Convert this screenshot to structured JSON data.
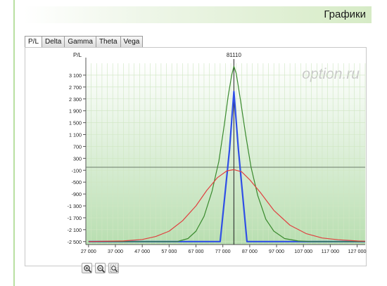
{
  "header": {
    "title": "Графики"
  },
  "tabs": [
    "P/L",
    "Delta",
    "Gamma",
    "Theta",
    "Vega"
  ],
  "active_tab": "P/L",
  "watermark": "option.ru",
  "zoom_buttons": [
    "zoom-in-icon",
    "zoom-out-icon",
    "zoom-reset-icon"
  ],
  "chart_data": {
    "type": "line",
    "ylabel": "P/L",
    "marker_label": "81110",
    "marker_x": 81110,
    "xlim": [
      26000,
      130000
    ],
    "ylim": [
      -2600,
      3500
    ],
    "x_ticks": [
      27000,
      37000,
      47000,
      57000,
      67000,
      77000,
      87000,
      97000,
      107000,
      117000,
      127000
    ],
    "x_tick_labels": [
      "27 000",
      "37 000",
      "47 000",
      "57 000",
      "67 000",
      "77 000",
      "87 000",
      "97 000",
      "107 000",
      "117 000",
      "127 000"
    ],
    "y_ticks": [
      3100,
      2700,
      2300,
      1900,
      1500,
      1100,
      700,
      300,
      -100,
      -500,
      -900,
      -1300,
      -1700,
      -2100,
      -2500
    ],
    "y_tick_labels": [
      "3 100",
      "2 700",
      "2 300",
      "1 900",
      "1 500",
      "1 100",
      "700",
      "300",
      "-100",
      "-500",
      "-900",
      "-1 300",
      "-1 700",
      "-2 100",
      "-2 500"
    ],
    "zero_line": 0,
    "colors": {
      "blue": "#2f4fe6",
      "green": "#3a8a2e",
      "red": "#e04040",
      "grid": "#cfe6c2",
      "background_top": "#ffffff",
      "background_bottom": "#b8deb0"
    },
    "series": [
      {
        "color": "#2f4fe6",
        "x": [
          27000,
          76000,
          79500,
          81110,
          82800,
          86000,
          130000
        ],
        "y": [
          -2500,
          -2500,
          600,
          2550,
          600,
          -2500,
          -2500
        ]
      },
      {
        "color": "#3a8a2e",
        "x": [
          27000,
          60000,
          64000,
          67000,
          70000,
          73000,
          75500,
          77500,
          79000,
          80300,
          81110,
          82000,
          83500,
          85500,
          87500,
          90000,
          93000,
          96000,
          100000,
          105000,
          110000,
          130000
        ],
        "y": [
          -2500,
          -2500,
          -2400,
          -2150,
          -1650,
          -800,
          200,
          1400,
          2400,
          3100,
          3400,
          3150,
          2300,
          1100,
          0,
          -950,
          -1750,
          -2150,
          -2400,
          -2480,
          -2500,
          -2500
        ]
      },
      {
        "color": "#e04040",
        "x": [
          27000,
          40000,
          47000,
          52000,
          57000,
          62000,
          67000,
          71000,
          75000,
          78500,
          81110,
          84000,
          87000,
          91000,
          96000,
          102000,
          108000,
          114000,
          120000,
          127000,
          130000
        ],
        "y": [
          -2500,
          -2480,
          -2430,
          -2330,
          -2150,
          -1800,
          -1300,
          -780,
          -350,
          -120,
          -80,
          -150,
          -420,
          -850,
          -1450,
          -1950,
          -2230,
          -2380,
          -2440,
          -2480,
          -2490
        ]
      }
    ]
  }
}
